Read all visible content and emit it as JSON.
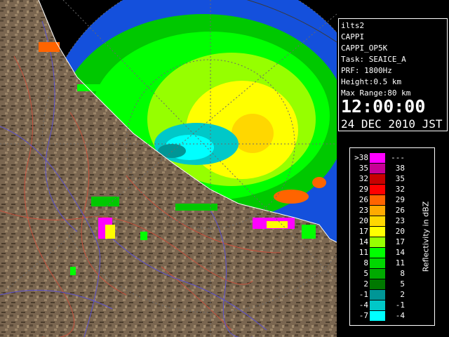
{
  "info": {
    "site": "ilts2",
    "product": "CAPPI",
    "product_id": "CAPPI_OP5K",
    "task": "Task: SEAICE_A",
    "prf": "PRF: 1800Hz",
    "height": "Height:0.5 km",
    "max_range": "Max Range:80 km",
    "time": "12:00:00",
    "date": "24 DEC 2010 JST"
  },
  "legend": {
    "unit_label": "Reflectivity in dBZ",
    "rows": [
      {
        "lo": ">38",
        "hi": "---",
        "color": "#ff00ff"
      },
      {
        "lo": "35",
        "hi": "38",
        "color": "#c80096"
      },
      {
        "lo": "32",
        "hi": "35",
        "color": "#c80000"
      },
      {
        "lo": "29",
        "hi": "32",
        "color": "#ff0000"
      },
      {
        "lo": "26",
        "hi": "29",
        "color": "#ff6400"
      },
      {
        "lo": "23",
        "hi": "26",
        "color": "#ffaa00"
      },
      {
        "lo": "20",
        "hi": "23",
        "color": "#ffd700"
      },
      {
        "lo": "17",
        "hi": "20",
        "color": "#ffff00"
      },
      {
        "lo": "14",
        "hi": "17",
        "color": "#96ff00"
      },
      {
        "lo": "11",
        "hi": "14",
        "color": "#00ff00"
      },
      {
        "lo": "8",
        "hi": "11",
        "color": "#00d700"
      },
      {
        "lo": "5",
        "hi": "8",
        "color": "#00aa00"
      },
      {
        "lo": "2",
        "hi": "5",
        "color": "#007800"
      },
      {
        "lo": "-1",
        "hi": "2",
        "color": "#009696"
      },
      {
        "lo": "-4",
        "hi": "-1",
        "color": "#00c8c8"
      },
      {
        "lo": "-7",
        "hi": "-4",
        "color": "#00ffff"
      }
    ]
  },
  "colors": {
    "range_area": "#1450dc",
    "land": "#7a6650",
    "rivers": "#5a50d0",
    "roads": "#c8503c"
  }
}
